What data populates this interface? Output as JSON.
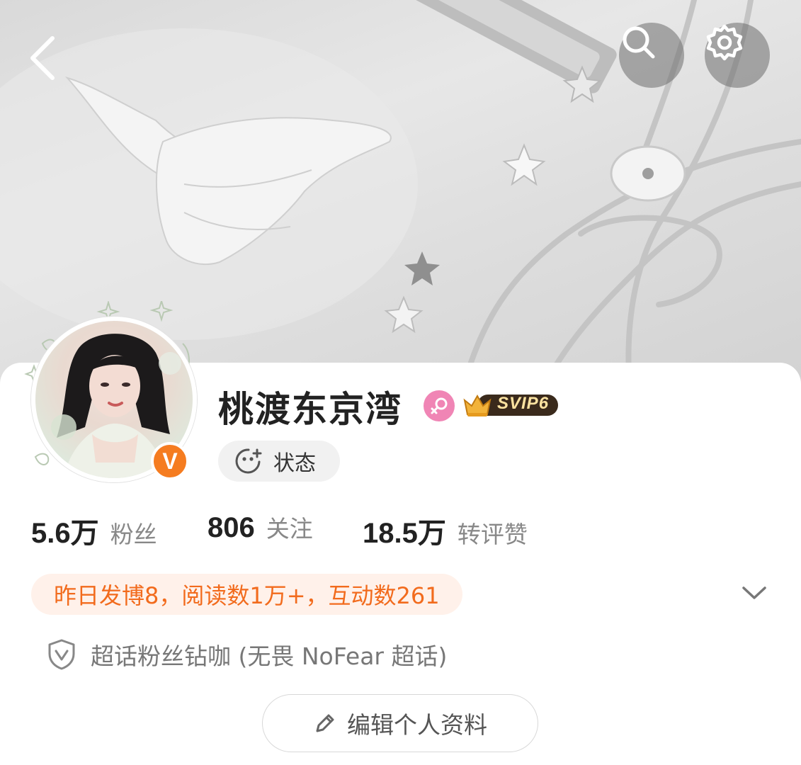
{
  "header": {
    "back_icon": "back-arrow-icon",
    "search_icon": "search-icon",
    "settings_icon": "gear-icon"
  },
  "profile": {
    "username": "桃渡东京湾",
    "gender_icon": "female-icon",
    "vip_badge": "SVIP6",
    "verified_badge": "V",
    "status_label": "状态"
  },
  "stats": [
    {
      "value": "5.6万",
      "label": "粉丝"
    },
    {
      "value": "806",
      "label": "关注"
    },
    {
      "value": "18.5万",
      "label": "转评赞"
    }
  ],
  "activity_summary": "昨日发博8，阅读数1万+，互动数261",
  "supertopic": "超话粉丝钻咖 (无畏 NoFear 超话)",
  "edit_profile_label": "编辑个人资料",
  "colors": {
    "accent_orange": "#f26b1d",
    "activity_bg": "#fff1ea",
    "gender_pink": "#f085b5",
    "verified_orange": "#f57c20"
  }
}
